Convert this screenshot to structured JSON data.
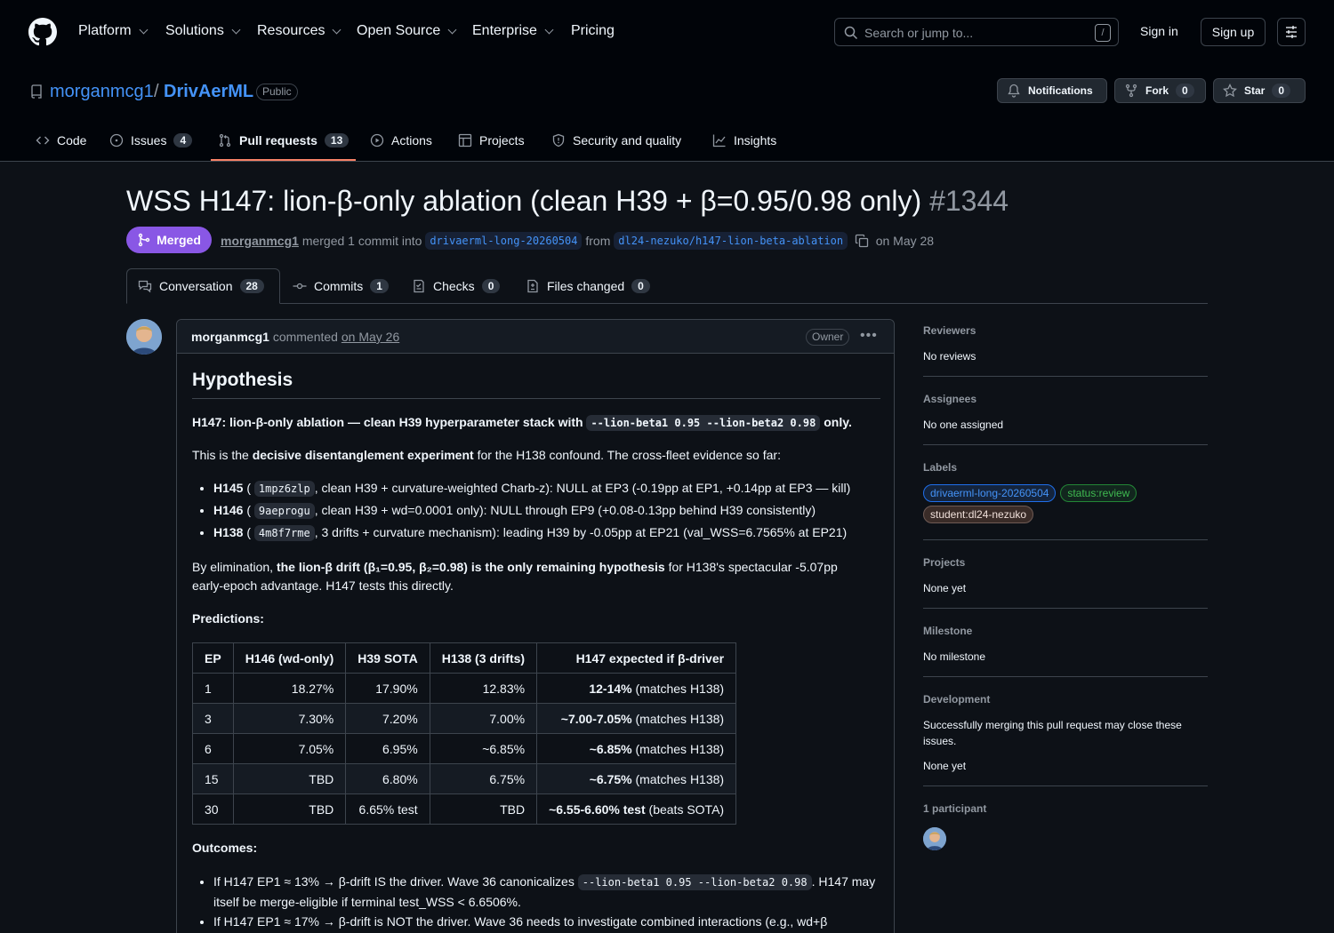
{
  "nav": {
    "items": [
      "Platform",
      "Solutions",
      "Resources",
      "Open Source",
      "Enterprise",
      "Pricing"
    ],
    "search_placeholder": "Search or jump to...",
    "slash": "/",
    "sign_in": "Sign in",
    "sign_up": "Sign up"
  },
  "repo": {
    "owner": "morganmcg1",
    "sep": "/",
    "name": "DrivAerML",
    "visibility": "Public",
    "notifications": "Notifications",
    "fork_label": "Fork",
    "fork_count": "0",
    "star_label": "Star",
    "star_count": "0",
    "tabs": [
      {
        "label": "Code",
        "count": ""
      },
      {
        "label": "Issues",
        "count": "4"
      },
      {
        "label": "Pull requests",
        "count": "13"
      },
      {
        "label": "Actions",
        "count": ""
      },
      {
        "label": "Projects",
        "count": ""
      },
      {
        "label": "Security and quality",
        "count": ""
      },
      {
        "label": "Insights",
        "count": ""
      }
    ]
  },
  "pr": {
    "title": "WSS H147: lion-β-only ablation (clean H39 + β=0.95/0.98 only)",
    "number": "#1344",
    "state": "Merged",
    "author": "morganmcg1",
    "merged_text": "merged 1 commit into",
    "base": "drivaerml-long-20260504",
    "from": "from",
    "head": "dl24-nezuko/h147-lion-beta-ablation",
    "date": "on May 28",
    "tabs": [
      {
        "label": "Conversation",
        "count": "28"
      },
      {
        "label": "Commits",
        "count": "1"
      },
      {
        "label": "Checks",
        "count": "0"
      },
      {
        "label": "Files changed",
        "count": "0"
      }
    ]
  },
  "comment": {
    "author": "morganmcg1",
    "verb": "commented",
    "date": "on May 26",
    "badge": "Owner",
    "heading": "Hypothesis",
    "lead_bold": "H147: lion-β-only ablation — clean H39 hyperparameter stack with",
    "lead_code": "--lion-beta1 0.95 --lion-beta2 0.98",
    "lead_end": "only.",
    "intro_a": "This is the",
    "intro_b": "decisive disentanglement experiment",
    "intro_c": "for the H138 confound. The cross-fleet evidence so far:",
    "bullets": [
      {
        "id": "H145",
        "hash": "1mpz6zlp",
        "text": ", clean H39 + curvature-weighted Charb-z): NULL at EP3 (-0.19pp at EP1, +0.14pp at EP3 — kill)"
      },
      {
        "id": "H146",
        "hash": "9aeprogu",
        "text": ", clean H39 + wd=0.0001 only): NULL through EP9 (+0.08-0.13pp behind H39 consistently)"
      },
      {
        "id": "H138",
        "hash": "4m8f7rme",
        "text": ", 3 drifts + curvature mechanism): leading H39 by -0.05pp at EP21 (val_WSS=6.7565% at EP21)"
      }
    ],
    "elim_a": "By elimination,",
    "elim_b": "the lion-β drift (β₁=0.95, β₂=0.98) is the only remaining hypothesis",
    "elim_c": "for H138's spectacular -5.07pp",
    "elim_d": "early-epoch advantage. H147 tests this directly.",
    "predictions": "Predictions:",
    "table": {
      "headers": [
        "EP",
        "H146 (wd-only)",
        "H39 SOTA",
        "H138 (3 drifts)",
        "H147 expected if β-driver"
      ],
      "rows": [
        [
          "1",
          "18.27%",
          "17.90%",
          "12.83%",
          "12-14%",
          " (matches H138)"
        ],
        [
          "3",
          "7.30%",
          "7.20%",
          "7.00%",
          "~7.00-7.05%",
          " (matches H138)"
        ],
        [
          "6",
          "7.05%",
          "6.95%",
          "~6.85%",
          "~6.85%",
          " (matches H138)"
        ],
        [
          "15",
          "TBD",
          "6.80%",
          "6.75%",
          "~6.75%",
          " (matches H138)"
        ],
        [
          "30",
          "TBD",
          "6.65% test",
          "TBD",
          "~6.55-6.60% test",
          " (beats SOTA)"
        ]
      ]
    },
    "outcomes": "Outcomes:",
    "out1_a": "If H147 EP1 ≈ 13% → β-drift IS the driver. Wave 36 canonicalizes",
    "out1_code": "--lion-beta1 0.95 --lion-beta2 0.98",
    "out1_b": ". H147 may",
    "out1_c": "itself be merge-eligible if terminal test_WSS < 6.6506%.",
    "out2": "If H147 EP1 ≈ 17% → β-drift is NOT the driver. Wave 36 needs to investigate combined interactions (e.g., wd+β"
  },
  "sidebar": {
    "reviewers_h": "Reviewers",
    "reviewers_v": "No reviews",
    "assignees_h": "Assignees",
    "assignees_v": "No one assigned",
    "labels_h": "Labels",
    "labels": [
      {
        "text": "drivaerml-long-20260504",
        "color": "#4493f8"
      },
      {
        "text": "status:review",
        "color": "#3fb950"
      },
      {
        "text": "student:dl24-nezuko",
        "color": "#e0c8c0"
      }
    ],
    "projects_h": "Projects",
    "projects_v": "None yet",
    "milestone_h": "Milestone",
    "milestone_v": "No milestone",
    "development_h": "Development",
    "development_v": "Successfully merging this pull request may close these issues.",
    "development_v2": "None yet",
    "participants_h": "1 participant"
  }
}
